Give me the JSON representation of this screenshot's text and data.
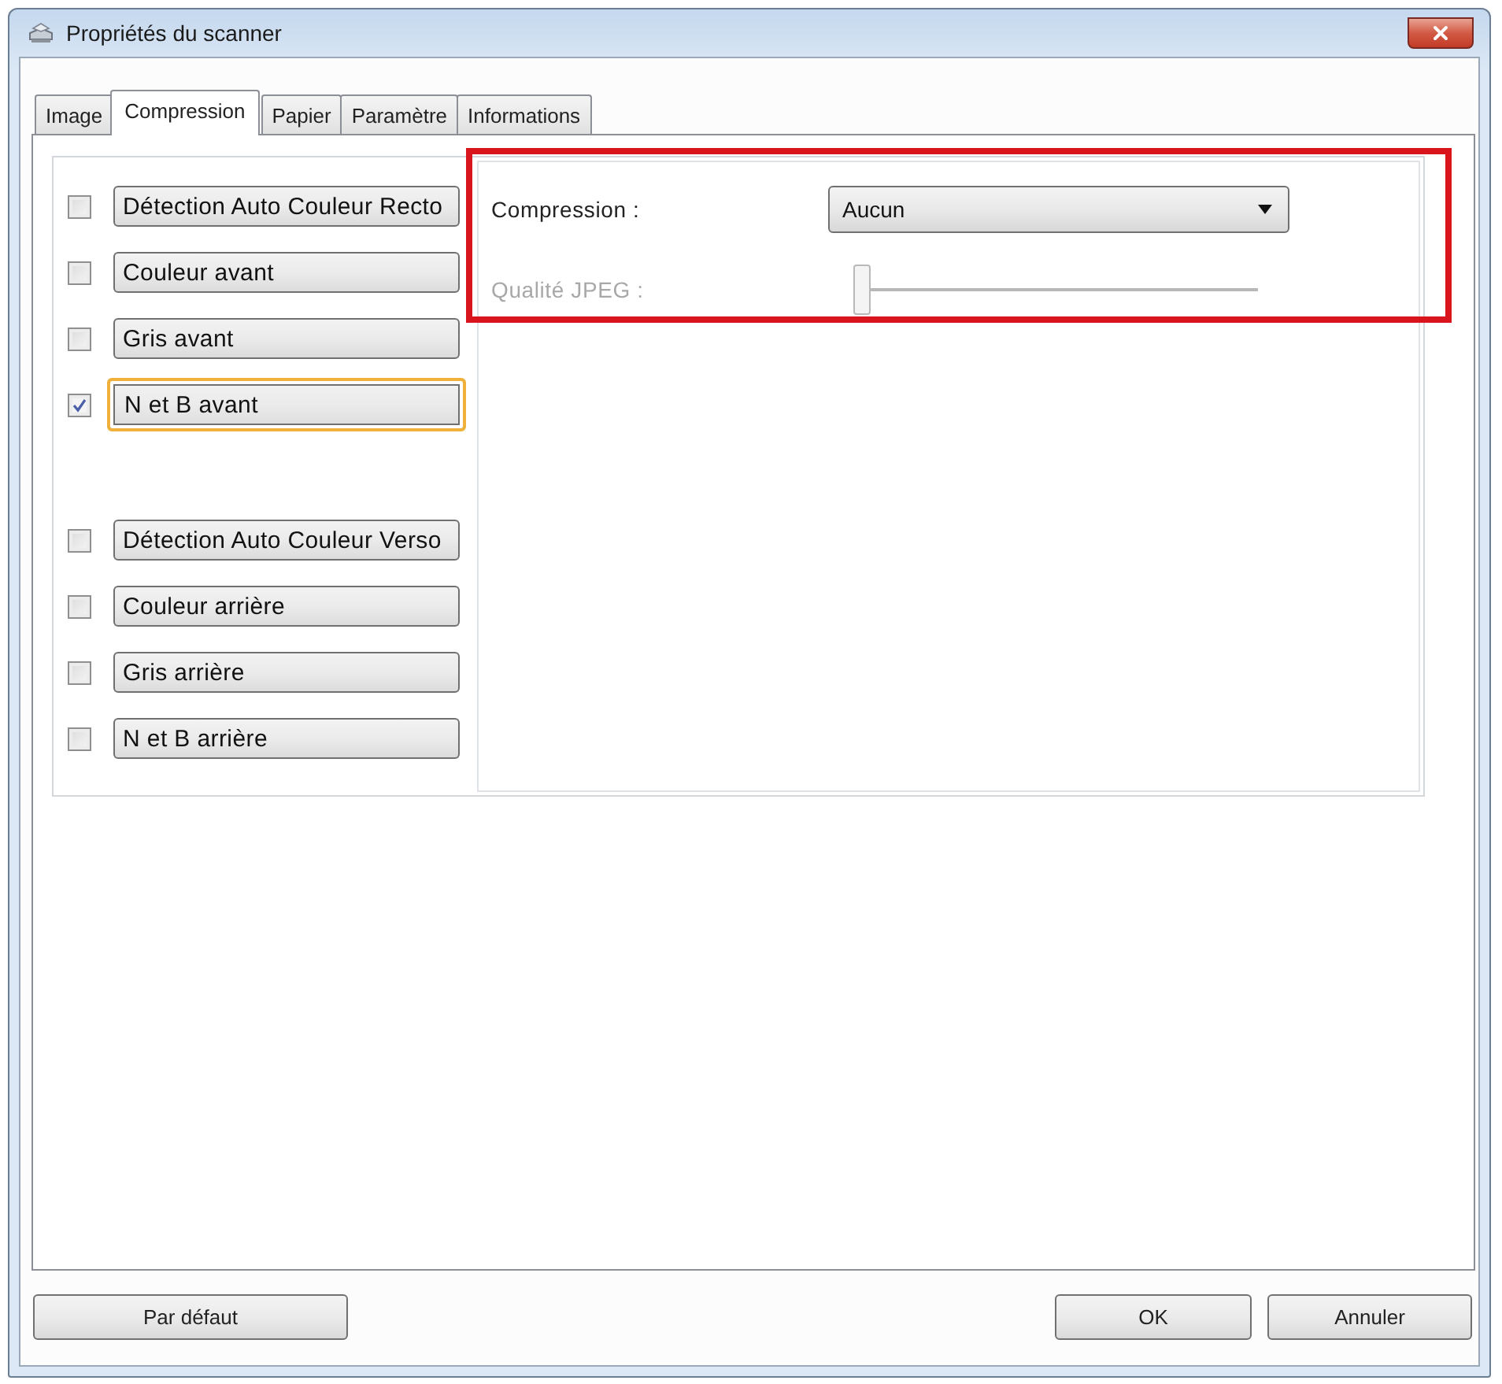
{
  "window": {
    "title": "Propriétés du scanner"
  },
  "tabs": [
    {
      "label": "Image",
      "selected": false
    },
    {
      "label": "Compression",
      "selected": true
    },
    {
      "label": "Papier",
      "selected": false
    },
    {
      "label": "Paramètre",
      "selected": false
    },
    {
      "label": "Informations",
      "selected": false
    }
  ],
  "front_options": [
    {
      "label": "Détection Auto Couleur Recto",
      "checked": false,
      "focused": false
    },
    {
      "label": "Couleur avant",
      "checked": false,
      "focused": false
    },
    {
      "label": "Gris avant",
      "checked": false,
      "focused": false
    },
    {
      "label": "N et B avant",
      "checked": true,
      "focused": true
    }
  ],
  "back_options": [
    {
      "label": "Détection Auto Couleur Verso",
      "checked": false,
      "focused": false
    },
    {
      "label": "Couleur arrière",
      "checked": false,
      "focused": false
    },
    {
      "label": "Gris arrière",
      "checked": false,
      "focused": false
    },
    {
      "label": "N et B arrière",
      "checked": false,
      "focused": false
    }
  ],
  "settings": {
    "highlighted": true,
    "compression": {
      "label": "Compression :",
      "value": "Aucun"
    },
    "jpeg_quality": {
      "label": "Qualité JPEG :",
      "disabled": true,
      "level": 0
    }
  },
  "buttons": [
    {
      "label": "Par défaut",
      "kind": "reset"
    },
    {
      "label": "OK",
      "kind": "confirm"
    },
    {
      "label": "Annuler",
      "kind": "cancel"
    }
  ]
}
